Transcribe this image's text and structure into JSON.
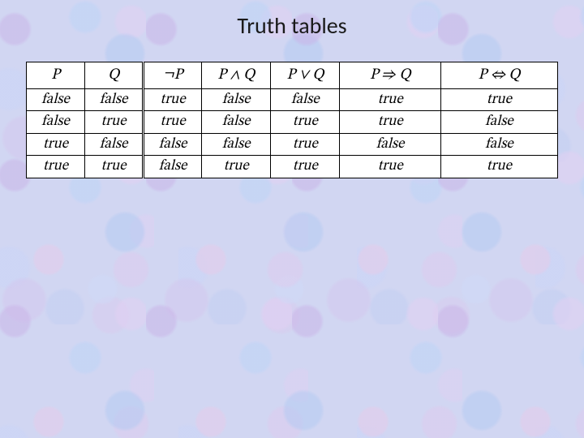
{
  "title": "Truth tables",
  "headers": {
    "p": "P",
    "q": "Q",
    "notp": "¬P",
    "pandq": "P ∧ Q",
    "porq": "P ∨ Q",
    "pimpq": "P  ⇒  Q",
    "piffq": "P  ⇔  Q"
  },
  "rows": [
    {
      "p": "false",
      "q": "false",
      "notp": "true",
      "pandq": "false",
      "porq": "false",
      "pimpq": "true",
      "piffq": "true"
    },
    {
      "p": "false",
      "q": "true",
      "notp": "true",
      "pandq": "false",
      "porq": "true",
      "pimpq": "true",
      "piffq": "false"
    },
    {
      "p": "true",
      "q": "false",
      "notp": "false",
      "pandq": "false",
      "porq": "true",
      "pimpq": "false",
      "piffq": "false"
    },
    {
      "p": "true",
      "q": "true",
      "notp": "false",
      "pandq": "true",
      "porq": "true",
      "pimpq": "true",
      "piffq": "true"
    }
  ],
  "chart_data": {
    "type": "table",
    "title": "Truth tables",
    "columns": [
      "P",
      "Q",
      "¬P",
      "P ∧ Q",
      "P ∨ Q",
      "P ⇒ Q",
      "P ⇔ Q"
    ],
    "rows": [
      [
        "false",
        "false",
        "true",
        "false",
        "false",
        "true",
        "true"
      ],
      [
        "false",
        "true",
        "true",
        "false",
        "true",
        "true",
        "false"
      ],
      [
        "true",
        "false",
        "false",
        "false",
        "true",
        "false",
        "false"
      ],
      [
        "true",
        "true",
        "false",
        "true",
        "true",
        "true",
        "true"
      ]
    ]
  }
}
